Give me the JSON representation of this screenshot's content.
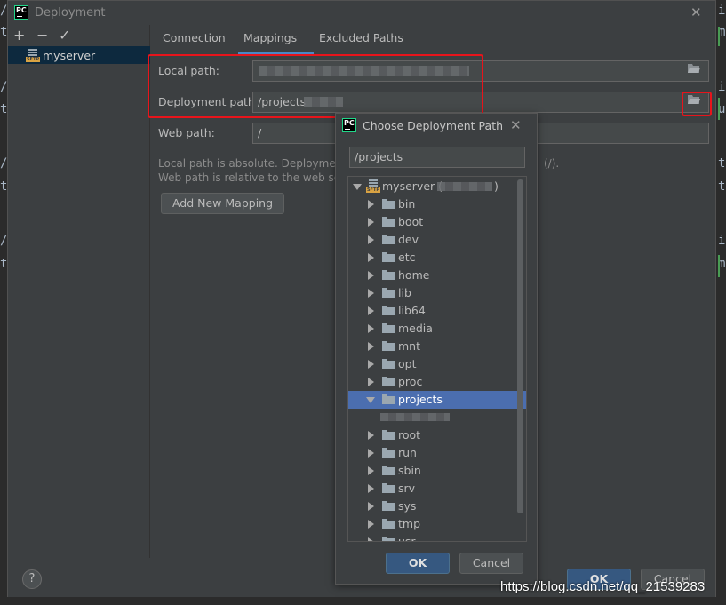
{
  "window": {
    "title": "Deployment",
    "close_symbol": "✕"
  },
  "toolbar": {
    "add_symbol": "+",
    "remove_symbol": "−",
    "check_symbol": "✓"
  },
  "servers": [
    {
      "label": "myserver",
      "icon": "sftp-server-icon"
    }
  ],
  "tabs": [
    {
      "label": "Connection"
    },
    {
      "label": "Mappings",
      "active": true
    },
    {
      "label": "Excluded Paths"
    }
  ],
  "mappings": {
    "local_path_label": "Local path:",
    "local_path_value": "",
    "deployment_path_label": "Deployment path:",
    "deployment_path_value": "/projects",
    "web_path_label": "Web path:",
    "web_path_value": "/",
    "hint_line1": "Local path is absolute. Deploymen",
    "hint_line1_end": "(/).",
    "hint_line2": "Web path is relative to the web se",
    "add_mapping_label": "Add New Mapping"
  },
  "footer": {
    "help_symbol": "?",
    "ok_label": "OK",
    "cancel_label": "Cancel"
  },
  "chooser": {
    "title": "Choose Deployment Path",
    "close_symbol": "✕",
    "path_value": "/projects",
    "root_label": "myserver (",
    "root_label_end": ")",
    "folders": [
      "bin",
      "boot",
      "dev",
      "etc",
      "home",
      "lib",
      "lib64",
      "media",
      "mnt",
      "opt",
      "proc",
      "projects",
      "",
      "root",
      "run",
      "sbin",
      "srv",
      "sys",
      "tmp",
      "usr"
    ],
    "selected_folder": "projects",
    "ok_label": "OK",
    "cancel_label": "Cancel"
  },
  "watermark": "https://blog.csdn.net/qq_21539283",
  "background_glyphs": {
    "left": [
      "/",
      "t",
      "/",
      "t",
      "/",
      "t",
      "/",
      "t"
    ],
    "right": [
      "i",
      "m",
      "i",
      "u",
      "t",
      "t",
      "i",
      "m"
    ]
  },
  "colors": {
    "dialog_bg": "#3c3f41",
    "selection": "#4b6eaf",
    "accent_tab": "#4a88c7",
    "highlight_box": "#e8141b",
    "primary_button": "#365880"
  }
}
